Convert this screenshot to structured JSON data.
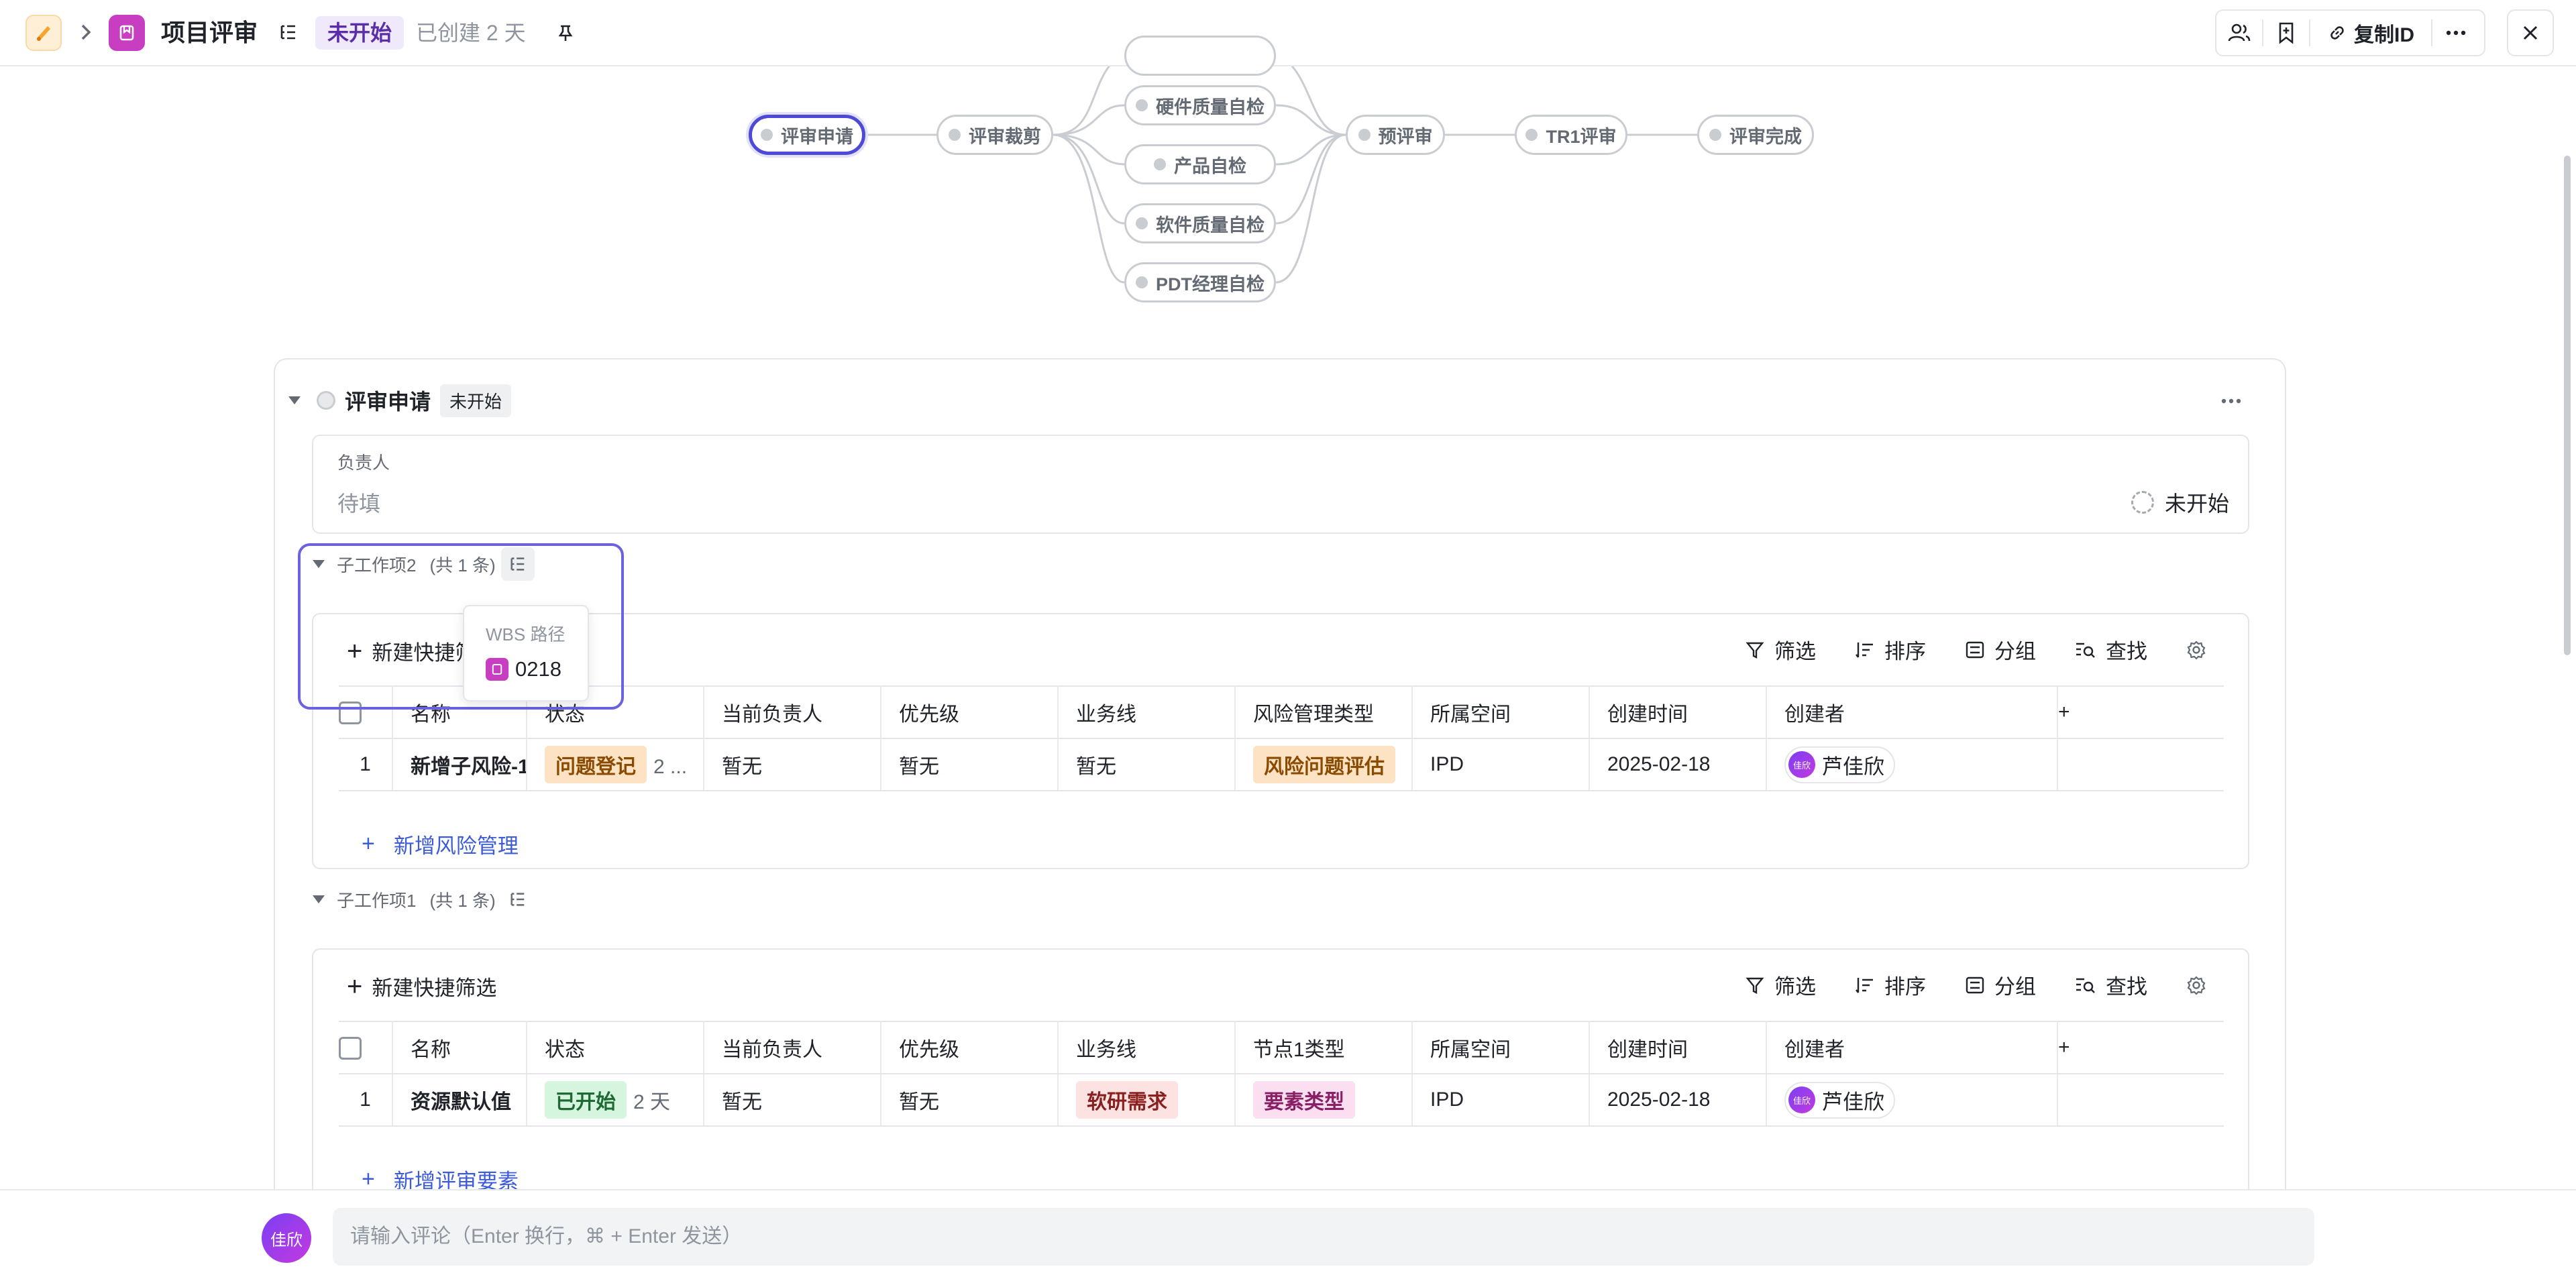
{
  "header": {
    "title": "项目评审",
    "status": "未开始",
    "created": "已创建 2 天",
    "copy_id_label": "复制ID"
  },
  "flow": {
    "nodes": [
      {
        "id": "review-apply",
        "label": "评审申请",
        "active": true
      },
      {
        "id": "review-trim",
        "label": "评审裁剪"
      },
      {
        "id": "hw-quality",
        "label": "硬件质量自检"
      },
      {
        "id": "product-check",
        "label": "产品自检"
      },
      {
        "id": "sw-quality",
        "label": "软件质量自检"
      },
      {
        "id": "pdt-check",
        "label": "PDT经理自检"
      },
      {
        "id": "pre-review",
        "label": "预评审"
      },
      {
        "id": "tr1-review",
        "label": "TR1评审"
      },
      {
        "id": "review-done",
        "label": "评审完成"
      }
    ]
  },
  "section": {
    "title": "评审申请",
    "badge": "未开始",
    "assignee_label": "负责人",
    "assignee_value": "待填",
    "assignee_status": "未开始"
  },
  "sub2": {
    "title": "子工作项2",
    "count": "(共 1 条)",
    "toolbar": {
      "new_filter": "新建快捷筛选",
      "filter": "筛选",
      "sort": "排序",
      "group": "分组",
      "find": "查找"
    },
    "columns": [
      "名称",
      "状态",
      "当前负责人",
      "优先级",
      "业务线",
      "风险管理类型",
      "所属空间",
      "创建时间",
      "创建者"
    ],
    "rows": [
      {
        "index": "1",
        "name": "新增子风险-1",
        "status": "问题登记",
        "status_days": "2 ...",
        "owner": "暂无",
        "priority": "暂无",
        "line": "暂无",
        "type": "风险问题评估",
        "space": "IPD",
        "created": "2025-02-18",
        "creator": "芦佳欣",
        "creator_avatar": "佳欣"
      }
    ],
    "add_label": "新增风险管理"
  },
  "tooltip": {
    "title": "WBS 路径",
    "value": "0218"
  },
  "sub1": {
    "title": "子工作项1",
    "count": "(共 1 条)",
    "toolbar": {
      "new_filter": "新建快捷筛选",
      "filter": "筛选",
      "sort": "排序",
      "group": "分组",
      "find": "查找"
    },
    "columns": [
      "名称",
      "状态",
      "当前负责人",
      "优先级",
      "业务线",
      "节点1类型",
      "所属空间",
      "创建时间",
      "创建者"
    ],
    "rows": [
      {
        "index": "1",
        "name": "资源默认值",
        "status": "已开始",
        "status_days": "2 天",
        "owner": "暂无",
        "priority": "暂无",
        "line": "软研需求",
        "type": "要素类型",
        "space": "IPD",
        "created": "2025-02-18",
        "creator": "芦佳欣",
        "creator_avatar": "佳欣"
      }
    ],
    "add_label": "新增评审要素"
  },
  "comment": {
    "avatar": "佳欣",
    "placeholder": "请输入评论（Enter 换行，⌘ + Enter 发送）"
  },
  "colors": {
    "accent": "#4c4ad6",
    "type_icon": "#c73ec1",
    "link": "#3b5bdb"
  }
}
